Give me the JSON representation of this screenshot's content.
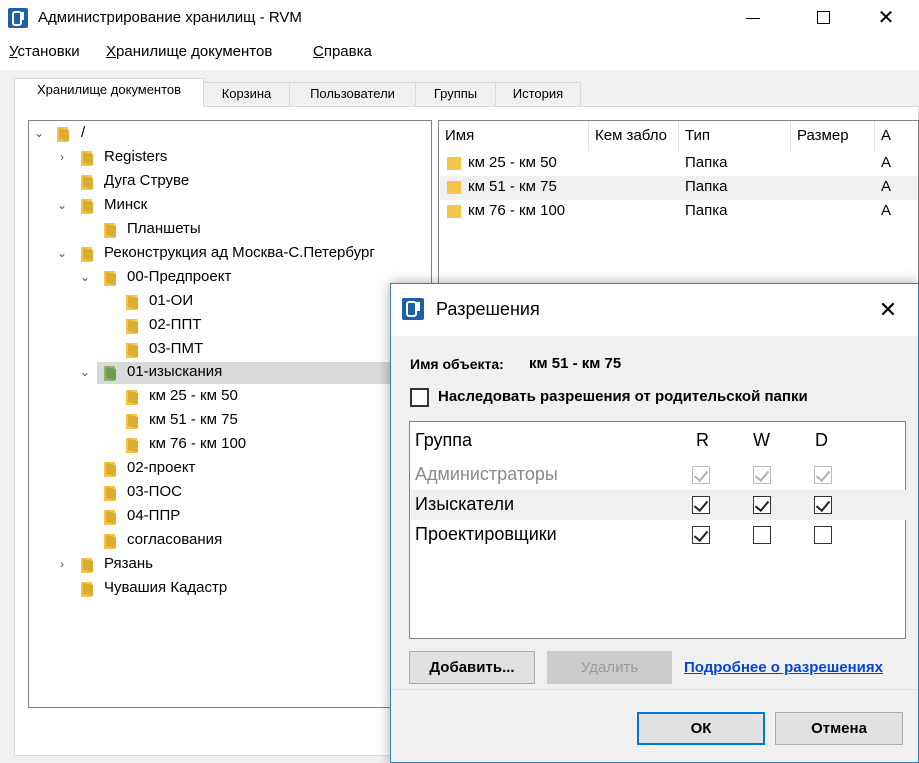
{
  "window": {
    "title": "Администрирование хранилищ - RVM",
    "min_glyph": "—",
    "close_glyph": "✕"
  },
  "menu": [
    "Установки",
    "Хранилище документов",
    "Справка"
  ],
  "tabs": [
    "Хранилище документов",
    "Корзина",
    "Пользователи",
    "Группы",
    "История"
  ],
  "tree": [
    {
      "label": "/",
      "chevron": "⌄"
    },
    {
      "label": "Registers",
      "chevron": "›"
    },
    {
      "label": "Дуга Струве",
      "chevron": ""
    },
    {
      "label": "Минск",
      "chevron": "⌄"
    },
    {
      "label": "Планшеты",
      "chevron": ""
    },
    {
      "label": "Реконструкция ад Москва-С.Петербург",
      "chevron": "⌄"
    },
    {
      "label": "00-Предпроект",
      "chevron": "⌄"
    },
    {
      "label": "01-ОИ",
      "chevron": ""
    },
    {
      "label": "02-ППТ",
      "chevron": ""
    },
    {
      "label": "03-ПМТ",
      "chevron": ""
    },
    {
      "label": "01-изыскания",
      "chevron": "⌄"
    },
    {
      "label": "км 25 - км 50",
      "chevron": ""
    },
    {
      "label": "км 51 - км 75",
      "chevron": ""
    },
    {
      "label": "км 76 - км 100",
      "chevron": ""
    },
    {
      "label": "02-проект",
      "chevron": ""
    },
    {
      "label": "03-ПОС",
      "chevron": ""
    },
    {
      "label": "04-ППР",
      "chevron": ""
    },
    {
      "label": "согласования",
      "chevron": ""
    },
    {
      "label": "Рязань",
      "chevron": "›"
    },
    {
      "label": "Чувашия Кадастр",
      "chevron": ""
    }
  ],
  "list": {
    "columns": [
      "Имя",
      "Кем забло",
      "Тип",
      "Размер",
      "А"
    ],
    "sort_glyph": "⌃",
    "rows": [
      {
        "name": "км 25 - км 50",
        "type": "Папка",
        "extra": "А"
      },
      {
        "name": "км 51 - км 75",
        "type": "Папка",
        "extra": "А"
      },
      {
        "name": "км 76 - км 100",
        "type": "Папка",
        "extra": "А"
      }
    ]
  },
  "dialog": {
    "title": "Разрешения",
    "close_glyph": "✕",
    "object_label": "Имя объекта:",
    "object_value": "км 51 - км 75",
    "inherit_label": "Наследовать разрешения от родительской папки",
    "inherit_checked": false,
    "headers": {
      "group": "Группа",
      "r": "R",
      "w": "W",
      "d": "D"
    },
    "rows": [
      {
        "name": "Администраторы",
        "r": true,
        "w": true,
        "d": true,
        "disabled": true
      },
      {
        "name": "Изыскатели",
        "r": true,
        "w": true,
        "d": true,
        "disabled": false
      },
      {
        "name": "Проектировщики",
        "r": true,
        "w": false,
        "d": false,
        "disabled": false
      }
    ],
    "add_button": "Добавить...",
    "delete_button": "Удалить",
    "more_link": "Подробнее о разрешениях",
    "ok_button": "ОК",
    "cancel_button": "Отмена"
  }
}
